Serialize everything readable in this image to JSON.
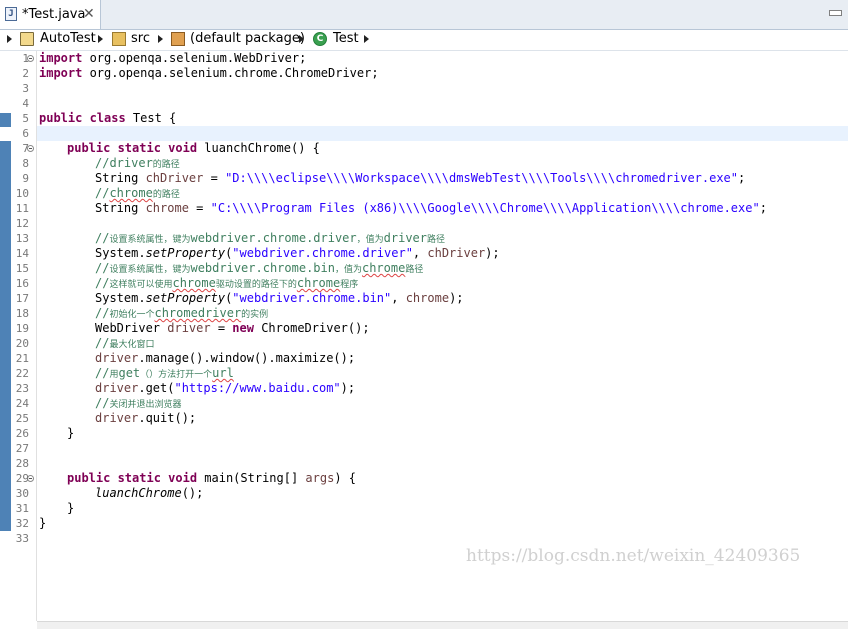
{
  "tab": {
    "title": "*Test.java",
    "close_glyph": "✕",
    "icon": "java-file-icon"
  },
  "breadcrumb": {
    "project": "AutoTest",
    "folder": "src",
    "package": "(default package)",
    "class": "Test",
    "class_icon_glyph": "C"
  },
  "editor": {
    "line_numbers": [
      "1",
      "2",
      "3",
      "4",
      "5",
      "6",
      "7",
      "8",
      "9",
      "10",
      "11",
      "12",
      "13",
      "14",
      "15",
      "16",
      "17",
      "18",
      "19",
      "20",
      "21",
      "22",
      "23",
      "24",
      "25",
      "26",
      "27",
      "28",
      "29",
      "30",
      "31",
      "32",
      "33"
    ],
    "lines": {
      "l1_kw": "import",
      "l1_rest": " org.openqa.selenium.WebDriver;",
      "l2_kw": "import",
      "l2_rest": " org.openqa.selenium.chrome.ChromeDriver;",
      "l5_kw": "public class",
      "l5_rest": " Test {",
      "l7_kw": "public static void",
      "l7_rest": " luanchChrome() {",
      "l8_cmt": "//driver",
      "l8_cmt_small": "的路径",
      "l9_type": "String ",
      "l9_var": "chDriver",
      "l9_eq": " = ",
      "l9_str": "\"D:\\\\\\\\eclipse\\\\\\\\Workspace\\\\\\\\dmsWebTest\\\\\\\\Tools\\\\\\\\chromedriver.exe\"",
      "l9_end": ";",
      "l10_cmt_pre": "//",
      "l10_cmt_sq": "chrome",
      "l10_cmt_small": "的路径",
      "l11_type": "String ",
      "l11_var": "chrome",
      "l11_eq": " = ",
      "l11_str": "\"C:\\\\\\\\Program Files (x86)\\\\\\\\Google\\\\\\\\Chrome\\\\\\\\Application\\\\\\\\chrome.exe\"",
      "l11_end": ";",
      "l13_cmt_pre": "//",
      "l13_cmt_small1": "设置系统属性，键为",
      "l13_cmt_mid": "webdriver.chrome.driver",
      "l13_cmt_small2": "，值为",
      "l13_cmt_end": "driver",
      "l13_cmt_small3": "路径",
      "l14_pre": "System.",
      "l14_it": "setProperty",
      "l14_open": "(",
      "l14_str": "\"webdriver.chrome.driver\"",
      "l14_mid": ", ",
      "l14_var": "chDriver",
      "l14_end": ");",
      "l15_cmt_pre": "//",
      "l15_cmt_small1": "设置系统属性，键为",
      "l15_cmt_mid": "webdriver.chrome.bin",
      "l15_cmt_small2": "，值为",
      "l15_cmt_sq": "chrome",
      "l15_cmt_small3": "路径",
      "l16_cmt_pre": "//",
      "l16_cmt_small1": "这样就可以使用",
      "l16_cmt_sq1": "chrome",
      "l16_cmt_small2": "驱动设置的路径下的",
      "l16_cmt_sq2": "chrome",
      "l16_cmt_small3": "程序",
      "l17_pre": "System.",
      "l17_it": "setProperty",
      "l17_open": "(",
      "l17_str": "\"webdriver.chrome.bin\"",
      "l17_mid": ", ",
      "l17_var": "chrome",
      "l17_end": ");",
      "l18_cmt_pre": "//",
      "l18_cmt_small1": "初始化一个",
      "l18_cmt_sq": "chromedriver",
      "l18_cmt_small2": "的实例",
      "l19_type": "WebDriver ",
      "l19_var": "driver",
      "l19_eq": " = ",
      "l19_kw": "new",
      "l19_end": " ChromeDriver();",
      "l20_cmt_pre": "//",
      "l20_cmt_small": "最大化窗口",
      "l21_var": "driver",
      "l21_end": ".manage().window().maximize();",
      "l22_cmt_pre": "//",
      "l22_cmt_small1": "用",
      "l22_cmt_get": "get",
      "l22_cmt_small2": "（）方法打开一个",
      "l22_cmt_sq": "url",
      "l23_var": "driver",
      "l23_mid": ".get(",
      "l23_str": "\"https://www.baidu.com\"",
      "l23_end": ");",
      "l24_cmt_pre": "//",
      "l24_cmt_small": "关闭并退出浏览器",
      "l25_var": "driver",
      "l25_end": ".quit();",
      "l26": "}",
      "l29_kw": "public static void",
      "l29_rest": " main(String[] ",
      "l29_var": "args",
      "l29_end": ") {",
      "l30_it": "luanchChrome",
      "l30_end": "();",
      "l31": "}",
      "l32": "}"
    }
  },
  "watermark": "https://blog.csdn.net/weixin_42409365",
  "colors": {
    "keyword": "#7f0055",
    "string": "#2a00ff",
    "comment": "#3f7f5f",
    "local_var": "#6a3e3e",
    "ruler": "#4e82b6",
    "current_line": "#e8f2fe"
  }
}
